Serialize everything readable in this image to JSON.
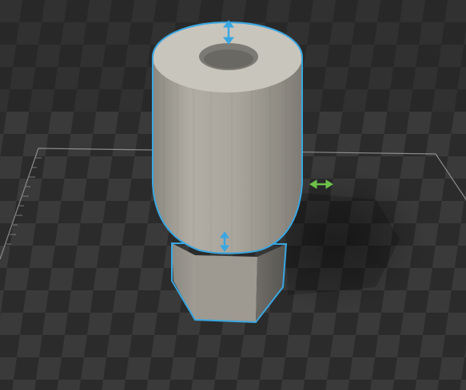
{
  "viewport": {
    "background_color": "#2b2b2b",
    "checker_dark": "#2a2a2a",
    "checker_light": "#3a3a3a",
    "build_plate_edge_color": "#9a9a9a",
    "ruler_color": "#8a8a8a"
  },
  "model": {
    "body_color": "#a6a29a",
    "selection_outline_color": "#3aa7e2"
  },
  "gizmos": {
    "top_handle": {
      "icon": "vertical-double-arrow-icon",
      "color": "#3aa7e2"
    },
    "middle_handle": {
      "icon": "vertical-double-arrow-icon",
      "color": "#3aa7e2"
    },
    "side_handle": {
      "icon": "horizontal-double-arrow-icon",
      "color": "#6cc04a"
    }
  }
}
